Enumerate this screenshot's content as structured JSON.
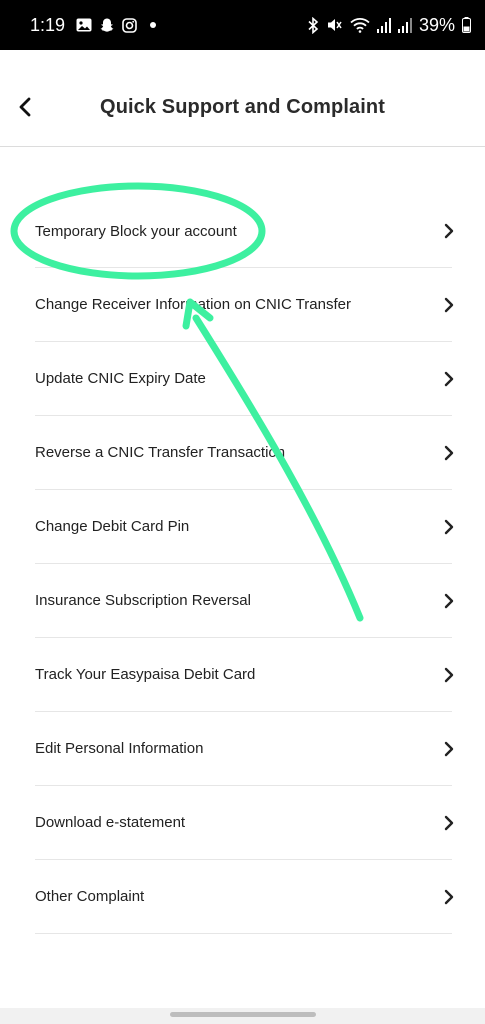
{
  "status_bar": {
    "time": "1:19",
    "battery": "39%",
    "left_icons": [
      "gallery-icon",
      "snapchat-icon",
      "instagram-icon",
      "notification-dot-icon"
    ],
    "right_icons": [
      "bluetooth-icon",
      "mute-icon",
      "wifi-icon",
      "signal-icon",
      "signal-icon",
      "battery-icon"
    ]
  },
  "header": {
    "title": "Quick Support and Complaint",
    "back_icon": "back-arrow-icon"
  },
  "menu": {
    "items": [
      {
        "label": "Temporary Block your account"
      },
      {
        "label": "Change Receiver Information on CNIC Transfer"
      },
      {
        "label": "Update CNIC Expiry Date"
      },
      {
        "label": "Reverse a CNIC Transfer Transaction"
      },
      {
        "label": "Change Debit Card Pin"
      },
      {
        "label": "Insurance Subscription Reversal"
      },
      {
        "label": "Track Your Easypaisa Debit Card"
      },
      {
        "label": "Edit Personal Information"
      },
      {
        "label": "Download e-statement"
      },
      {
        "label": "Other Complaint"
      }
    ],
    "chevron_icon": "chevron-right-icon"
  },
  "annotation": {
    "color": "#3df0a0",
    "highlighted_item": "Temporary Block your account"
  }
}
